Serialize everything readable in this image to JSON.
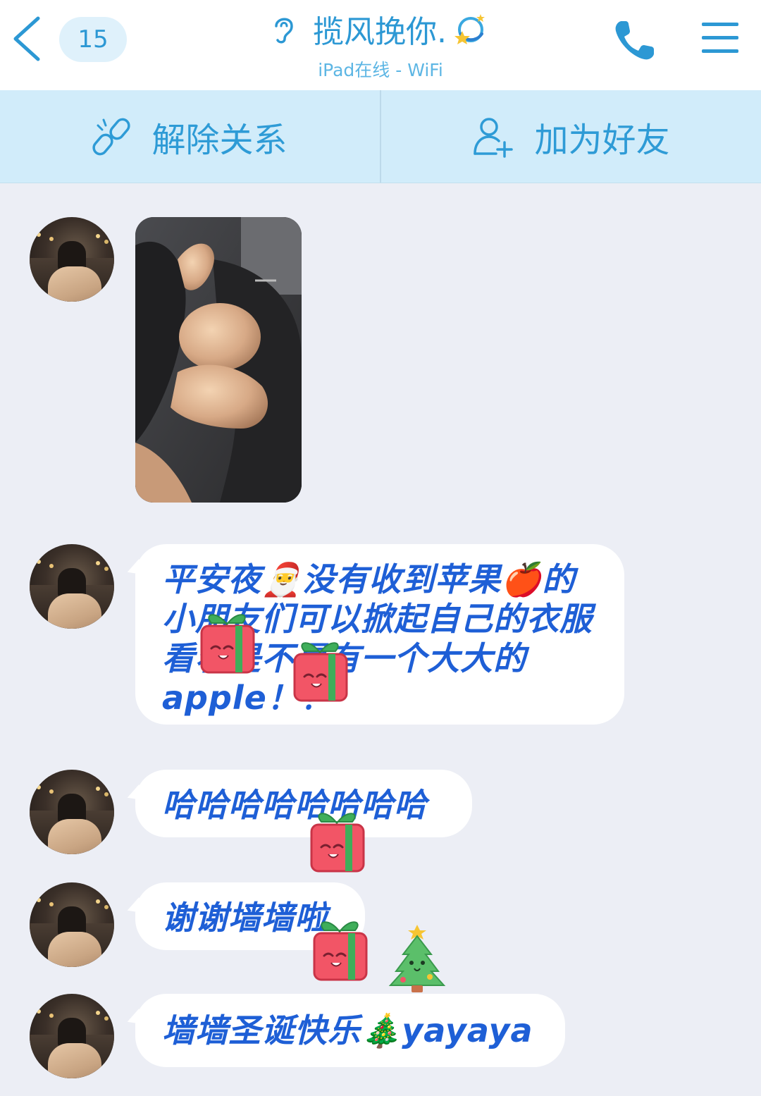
{
  "topbar": {
    "unread_count": "15",
    "title": "揽风挽你.",
    "subtitle": "iPad在线 - WiFi",
    "accent": "#2c98d4"
  },
  "actions": {
    "unbind_label": "解除关系",
    "add_friend_label": "加为好友",
    "background": "#d1ecfa"
  },
  "messages": [
    {
      "type": "image"
    },
    {
      "type": "text",
      "text": "平安夜🎅没有收到苹果🍎的小朋友们可以掀起自己的衣服看看是不是有一个大大的apple！！"
    },
    {
      "type": "text",
      "text": "哈哈哈哈哈哈哈哈"
    },
    {
      "type": "text",
      "text": "谢谢墙墙啦"
    },
    {
      "type": "text",
      "text": "墙墙圣诞快乐🎄yayaya"
    }
  ],
  "icons": {
    "back": "chevron-left-icon",
    "ear": "ear-icon",
    "phone": "phone-icon",
    "menu": "menu-icon",
    "unbind": "broken-link-icon",
    "add_friend": "add-user-icon"
  },
  "colors": {
    "message_text": "#1e5fd6",
    "chat_background": "#eceef5"
  }
}
